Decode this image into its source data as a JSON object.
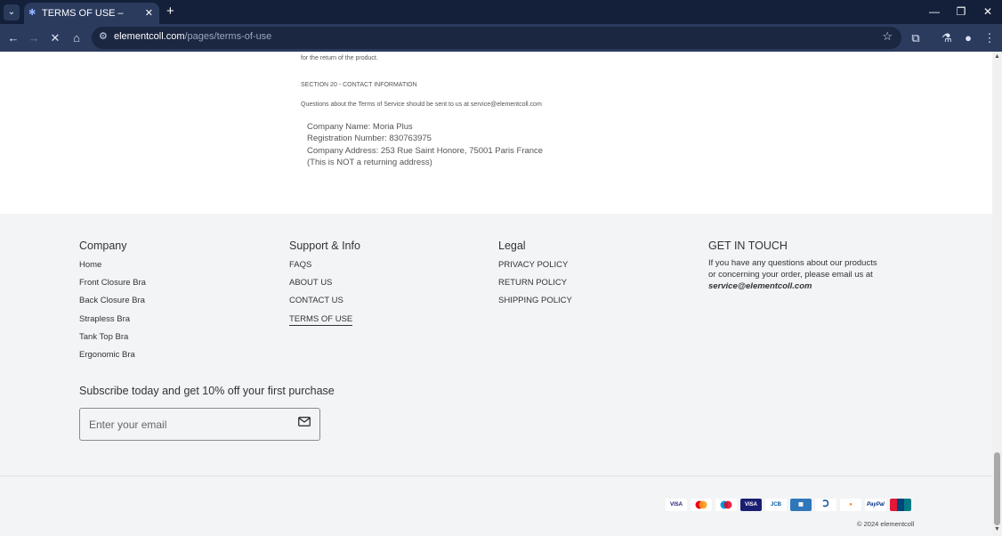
{
  "browser": {
    "tab_title": "TERMS OF USE – elementcoll",
    "url_host": "elementcoll.com",
    "url_path": "/pages/terms-of-use"
  },
  "policy": {
    "cut_line": "for the return of the product.",
    "section_heading": "SECTION 20 - CONTACT INFORMATION",
    "questions_line": "Questions about the Terms of Service should be sent to us at service@elementcoll.com",
    "company_lines": [
      "Company Name: Moria Plus",
      "Registration Number: 830763975",
      "Company Address: 253 Rue Saint Honore, 75001 Paris France",
      "(This is NOT a returning address)"
    ]
  },
  "footer": {
    "company": {
      "heading": "Company",
      "links": [
        "Home",
        "Front Closure Bra",
        "Back Closure Bra",
        "Strapless Bra",
        "Tank Top Bra",
        "Ergonomic Bra"
      ]
    },
    "support": {
      "heading": "Support & Info",
      "links": [
        "FAQS",
        "ABOUT US",
        "CONTACT US",
        "TERMS OF USE"
      ]
    },
    "legal": {
      "heading": "Legal",
      "links": [
        "PRIVACY POLICY",
        "RETURN POLICY",
        "SHIPPING POLICY"
      ]
    },
    "contact": {
      "heading": "GET IN TOUCH",
      "text": "If you have any questions about our products or concerning your order, please email us at",
      "email": "service@elementcoll.com"
    },
    "subscribe": {
      "heading": "Subscribe today and get 10% off your first purchase",
      "placeholder": "Enter your email"
    },
    "payments": [
      "VISA",
      "",
      "",
      "VISA",
      "JCB",
      "",
      "",
      "",
      "PayPal",
      ""
    ],
    "copyright": "© 2024 elementcoll"
  }
}
